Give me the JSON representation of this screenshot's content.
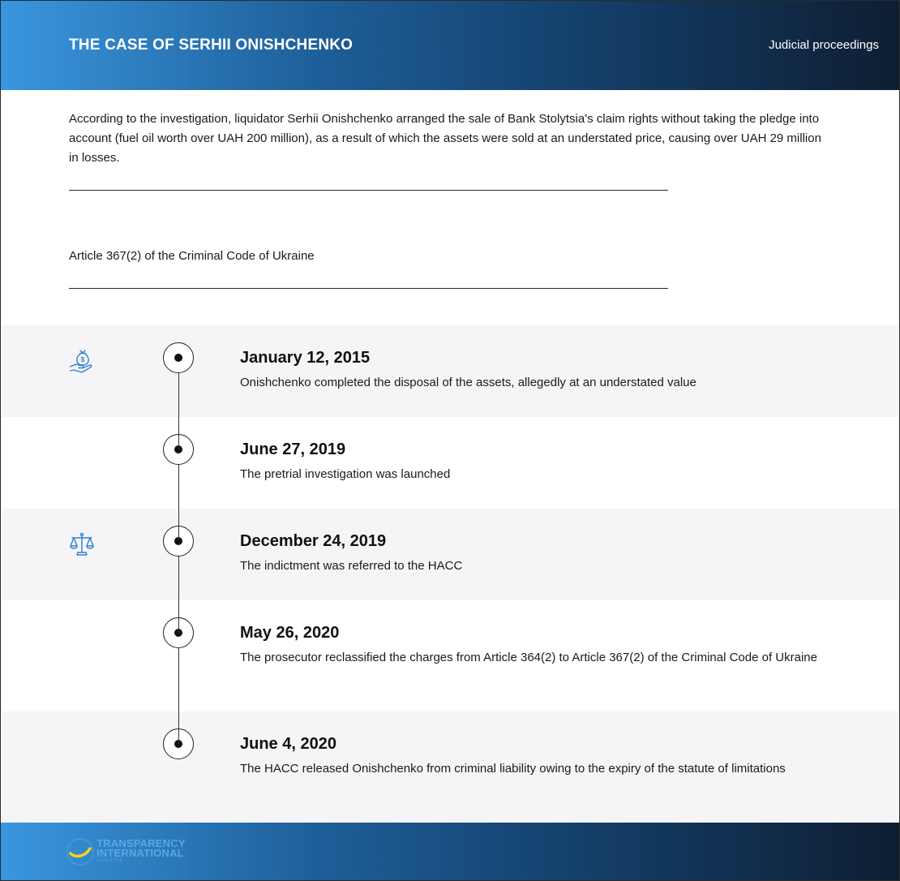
{
  "header": {
    "title": "THE CASE OF SERHII ONISHCHENKO",
    "category": "Judicial proceedings"
  },
  "description": "According to the investigation, liquidator Serhii Onishchenko arranged the sale of Bank Stolytsia's claim rights without taking the pledge into account (fuel oil worth over UAH 200 million), as a result of which the assets were sold at an understated price, causing over UAH 29 million in losses.",
  "article": "Article 367(2) of the Criminal Code of Ukraine",
  "timeline": [
    {
      "date": "January 12, 2015",
      "text": "Onishchenko completed the disposal of the assets, allegedly at an understated value",
      "icon": "money-bag-hand-icon"
    },
    {
      "date": "June 27, 2019",
      "text": "The pretrial investigation was launched",
      "icon": ""
    },
    {
      "date": "December 24, 2019",
      "text": "The indictment was referred to the HACC",
      "icon": "scales-of-justice-icon"
    },
    {
      "date": "May 26, 2020",
      "text": "The prosecutor reclassified the charges from Article 364(2) to Article 367(2) of the Criminal Code of Ukraine",
      "icon": ""
    },
    {
      "date": "June 4, 2020",
      "text": "The HACC released Onishchenko from criminal liability owing to the expiry of the statute of limitations",
      "icon": ""
    }
  ],
  "footer": {
    "logo_line1": "TRANSPARENCY",
    "logo_line2": "INTERNATIONAL",
    "logo_line3": "UKRAINE"
  },
  "colors": {
    "accent_blue": "#3a96de",
    "dark_navy": "#0e1e32",
    "icon_blue": "#2f7fd0",
    "row_shade": "#f5f5f7",
    "logo_yellow": "#f5d21a"
  }
}
